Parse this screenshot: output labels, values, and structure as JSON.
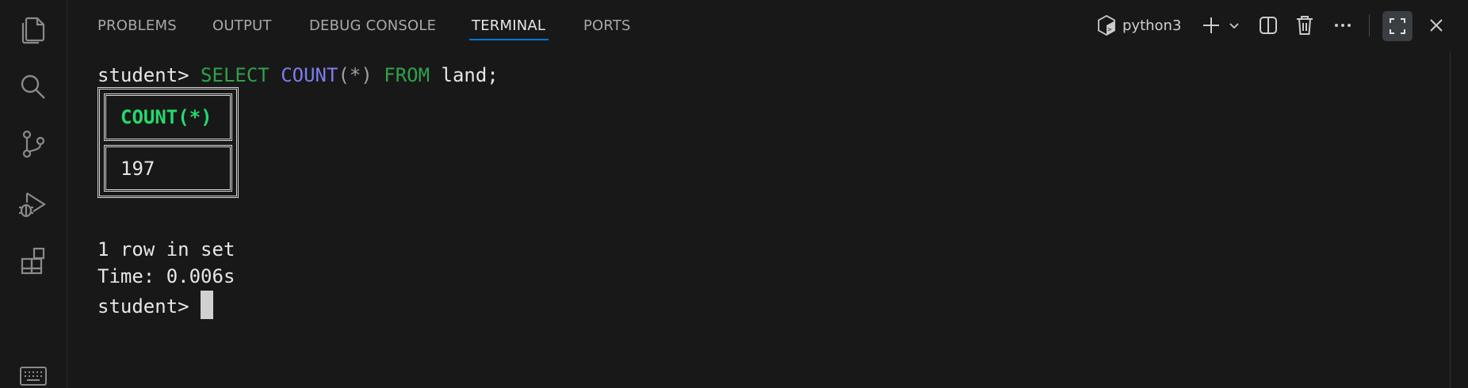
{
  "activity_bar": {
    "icons": [
      "explorer-icon",
      "search-icon",
      "source-control-icon",
      "run-debug-icon",
      "extensions-icon",
      "keyboard-icon"
    ]
  },
  "panel": {
    "tabs": [
      {
        "label": "PROBLEMS",
        "active": false
      },
      {
        "label": "OUTPUT",
        "active": false
      },
      {
        "label": "DEBUG CONSOLE",
        "active": false
      },
      {
        "label": "TERMINAL",
        "active": true
      },
      {
        "label": "PORTS",
        "active": false
      }
    ],
    "terminal_profile": "python3",
    "accent_color": "#0078d4"
  },
  "terminal": {
    "prompt": "student> ",
    "command": {
      "select": "SELECT",
      "count": "COUNT",
      "args": "(*)",
      "from": "FROM",
      "rest": "land;"
    },
    "result_table": {
      "header": "COUNT(*)",
      "value": "197"
    },
    "summary": "1 row in set",
    "time": "Time: 0.006s",
    "final_prompt": "student> "
  },
  "colors": {
    "keyword": "#2fa24a",
    "function": "#7c7cf2",
    "header": "#26d86b",
    "background": "#181818"
  }
}
